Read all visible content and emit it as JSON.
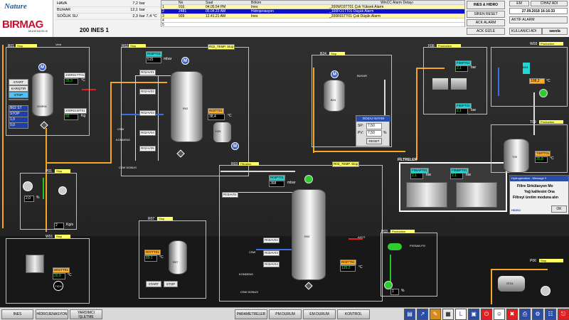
{
  "header": {
    "logo_nature": "Nature",
    "logo_birmag": "BIRMAG",
    "logo_sub": "MUHENDISLIK",
    "screen_title": "200 INES 1",
    "utilities": [
      {
        "name": "HAVA",
        "value": "7,2",
        "unit": "bar"
      },
      {
        "name": "BUHAR",
        "value": "12,1",
        "unit": "bar"
      },
      {
        "name": "SOĞUK SU",
        "value": "2,3",
        "unit": "bar   7,4 °C"
      }
    ],
    "alarm_headers": [
      "No",
      "Saat",
      "Bölüm",
      "WinCC Alarm Detayı"
    ],
    "alarms": [
      {
        "idx": "1",
        "no": "916",
        "time": "04.05.54 PM",
        "section": "Ines",
        "detail": "_200WO3TT01  Çok Yüksek Alarm"
      },
      {
        "idx": "2",
        "no": "2481",
        "time": "05.04.23 AM",
        "section": "Hidrojenasyon",
        "detail": "_100FO1TT01  Düşük Alarm"
      },
      {
        "idx": "3",
        "no": "939",
        "time": "12.41.21 AM",
        "section": "Ines",
        "detail": "_200R01TT01  Çok Düşük Alarm"
      },
      {
        "idx": "4",
        "no": "",
        "time": "",
        "section": "",
        "detail": ""
      },
      {
        "idx": "5",
        "no": "",
        "time": "",
        "section": "",
        "detail": ""
      }
    ],
    "buttons": {
      "ines_hidro": "INES & HIDRO",
      "em": "EM",
      "cihaz_adi": "CİHAZ ADI",
      "siren_reset": "SİREN RESET",
      "datetime": "27.09.2018 16:16:33",
      "ack_alarm": "ACK ALARM",
      "aktif_alarm": "AKTİF ALARM",
      "ack_gizle": "ACK GİZLE",
      "kullanici_adi": "KULLANICI ADI",
      "user": "savola"
    }
  },
  "process": {
    "b01": {
      "tag": "B01",
      "status": "Stop",
      "vent": "Vent",
      "start": "START",
      "karistir": "KARIŞTIR",
      "stop": "STOP",
      "tt_val": "25,3",
      "tt_unit": "°C",
      "wt_val": "56",
      "wt_unit": "Kg",
      "tank": "200R01",
      "side1": "B02 ST",
      "side2": "STOP",
      "side3": "1,0",
      "side4": "0,0"
    },
    "r02": {
      "tag": "R02",
      "status": "Stop",
      "pt_val": "515",
      "pt_unit": "mbar",
      "temp_val": "38,4",
      "temp_unit": "°C",
      "h25": "H25",
      "r02": "R02",
      "kondens": "KONDENS",
      "csw": "CSW",
      "csw_donus": "CSW DONUS"
    },
    "b24": {
      "tag": "B24",
      "status": "Stop",
      "tank": "B24",
      "buhar": "BUHAR",
      "dozaj": "DOZAJ SAYISI",
      "sp_val": "7,50",
      "pv_val": "7,50",
      "pv_unit": "%",
      "reset": "RESET"
    },
    "r03": {
      "tag": "R03",
      "status": "Filtration",
      "pt_val": "368",
      "pt_unit": "mbar",
      "temp_val": "125,2",
      "temp_unit": "°C",
      "tank": "R03",
      "kondens": "KONDENS",
      "csw": "CSW",
      "csw_donus": "CSW DONUS",
      "azot": "AZOT"
    },
    "f06": {
      "tag": "F06",
      "status": "Production",
      "pt1": "2,1",
      "pt2": "2,1",
      "unit": "bar"
    },
    "w03": {
      "tag": "W03",
      "status": "Production",
      "val": "108,2",
      "unit": "°C",
      "tank": "W03"
    },
    "t09": {
      "tag": "T09",
      "status": "Production",
      "val": "25,8",
      "unit": "°C",
      "tank": "T09"
    },
    "filtreler": {
      "title": "FİLTRELER",
      "pt1": "2,1",
      "pt2": "2,1",
      "unit": "bar"
    },
    "p01": {
      "tag": "P01",
      "status": "Stop",
      "val": "2,0",
      "unit": "%",
      "flow": "2",
      "flow_unit": "Kg/s"
    },
    "r07": {
      "tag": "R07",
      "status": "Stop",
      "temp": "89,1",
      "temp_unit": "°C",
      "tank": "R07",
      "start": "START",
      "stop": "STOP"
    },
    "w01": {
      "tag": "W01",
      "status": "Stop",
      "val": "20,9",
      "unit": "°C",
      "tich": "TICH"
    },
    "p03": {
      "tag": "P03",
      "status": "Production",
      "val": "1",
      "unit": "%",
      "pigs": "PİGSAN PO"
    },
    "p06": {
      "tag": "P06",
      "status": "Stop",
      "tank": "ST01"
    }
  },
  "message_box": {
    "title": "Hydrogenation - Message 2",
    "line1": "Filtre Sirkülasyon Mo",
    "line2": "Yağ kalitesini Ona",
    "line3": "Filtreyi üretim moduna alın",
    "ok": "OK",
    "footer": "HİDRO"
  },
  "nav": {
    "ines": "INES",
    "hidro": "HİDROJENASYON",
    "yardimci": "YARDIMCI İŞLETME",
    "parametreler": "PARAMETRELER",
    "pm_durum": "PM DURUM",
    "em_durum": "EM DURUM",
    "kontrol": "KONTROL"
  }
}
